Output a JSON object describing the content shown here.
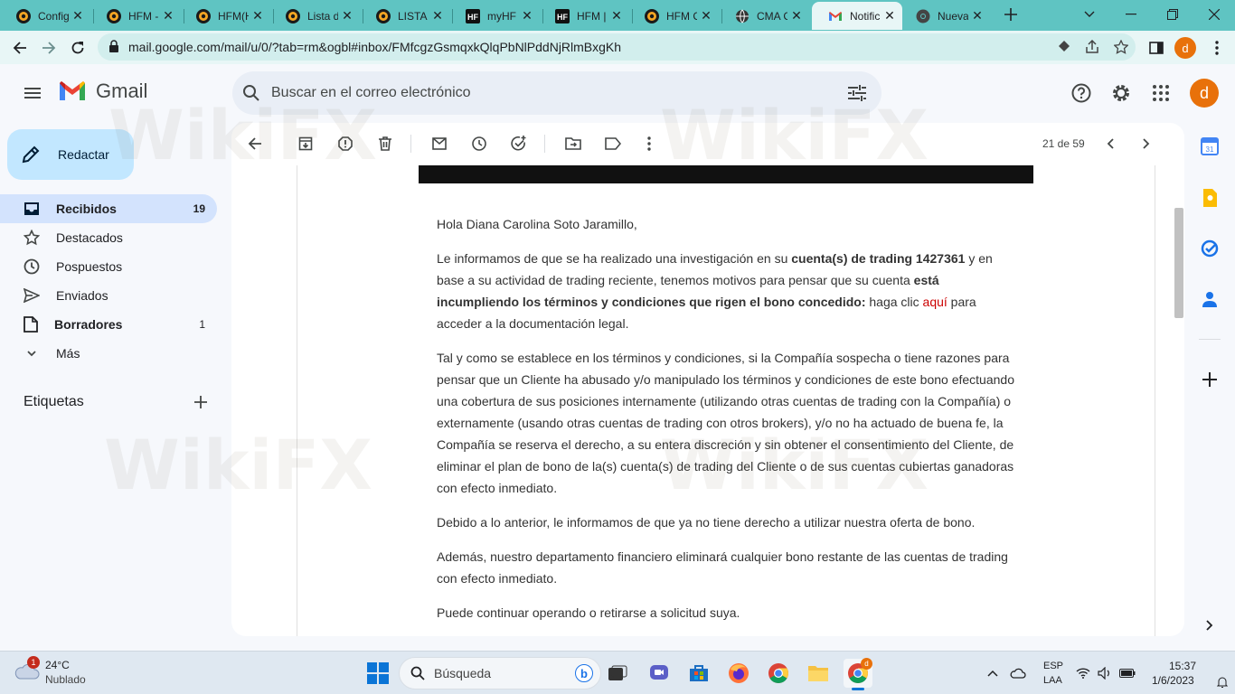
{
  "browser": {
    "tabs": [
      {
        "title": "Config",
        "icon": "hfm-logo-icon"
      },
      {
        "title": "HFM -",
        "icon": "hfm-logo-icon"
      },
      {
        "title": "HFM(H",
        "icon": "hfm-logo-icon"
      },
      {
        "title": "Lista d",
        "icon": "hfm-logo-icon"
      },
      {
        "title": "LISTA I",
        "icon": "hfm-logo-icon"
      },
      {
        "title": "myHF",
        "icon": "hf-logo-icon"
      },
      {
        "title": "HFM |",
        "icon": "hf-logo-icon"
      },
      {
        "title": "HFM C",
        "icon": "hfm-logo-icon"
      },
      {
        "title": "CMA C",
        "icon": "globe-icon"
      },
      {
        "title": "Notific",
        "icon": "gmail-icon",
        "active": true
      },
      {
        "title": "Nueva",
        "icon": "chrome-icon"
      }
    ],
    "url": "mail.google.com/mail/u/0/?tab=rm&ogbl#inbox/FMfcgzGsmqxkQlqPbNlPddNjRlmBxgKh",
    "profile_initial": "d"
  },
  "gmail": {
    "logo_text": "Gmail",
    "search_placeholder": "Buscar en el correo electrónico",
    "avatar_initial": "d",
    "compose_label": "Redactar",
    "nav": [
      {
        "label": "Recibidos",
        "count": "19",
        "bold": true,
        "active": true,
        "icon": "inbox-icon"
      },
      {
        "label": "Destacados",
        "count": "",
        "icon": "star-icon"
      },
      {
        "label": "Pospuestos",
        "count": "",
        "icon": "clock-icon"
      },
      {
        "label": "Enviados",
        "count": "",
        "icon": "send-icon"
      },
      {
        "label": "Borradores",
        "count": "1",
        "bold": true,
        "icon": "draft-icon"
      },
      {
        "label": "Más",
        "count": "",
        "icon": "chevron-down-icon"
      }
    ],
    "labels_heading": "Etiquetas",
    "pager": "21 de 59"
  },
  "email": {
    "greeting": "Hola Diana Carolina Soto Jaramillo,",
    "p1_a": "Le informamos de que se ha realizado una investigación en su ",
    "p1_b": "cuenta(s) de trading 1427361",
    "p1_c": " y en base a su actividad de trading reciente, tenemos motivos para pensar que su cuenta ",
    "p1_d": "está incumpliendo los términos y condiciones que rigen el bono concedido:",
    "p1_e": " haga clic ",
    "p1_link": "aquí",
    "p1_f": " para acceder a la documentación legal.",
    "p2": "Tal y como se establece en los términos y condiciones, si la Compañía sospecha o tiene razones para pensar que un Cliente ha abusado y/o manipulado los términos y condiciones de este bono efectuando una cobertura de sus posiciones internamente (utilizando otras cuentas de trading con la Compañía) o externamente (usando otras cuentas de trading con otros brokers), y/o no ha actuado de buena fe, la Compañía se reserva el derecho, a su entera discreción y sin obtener el consentimiento del Cliente, de eliminar el plan de bono de la(s) cuenta(s) de trading del Cliente o de sus cuentas cubiertas ganadoras con efecto inmediato.",
    "p3": "Debido a lo anterior, le informamos de que ya no tiene derecho a utilizar nuestra oferta de bono.",
    "p4": "Además, nuestro departamento financiero eliminará cualquier bono restante de las cuentas de trading con efecto inmediato.",
    "p5": "Puede continuar operando o retirarse a solicitud suya."
  },
  "watermark": "WikiFX",
  "taskbar": {
    "weather_temp": "24°C",
    "weather_desc": "Nublado",
    "weather_badge": "1",
    "search_placeholder": "Búsqueda",
    "lang_1": "ESP",
    "lang_2": "LAA",
    "time": "15:37",
    "date": "1/6/2023"
  },
  "colors": {
    "tabbar": "#5fc4c2",
    "accent": "#0b57d0",
    "selected_nav": "#d3e3fd",
    "compose": "#c2e7ff",
    "avatar": "#e8710a"
  }
}
